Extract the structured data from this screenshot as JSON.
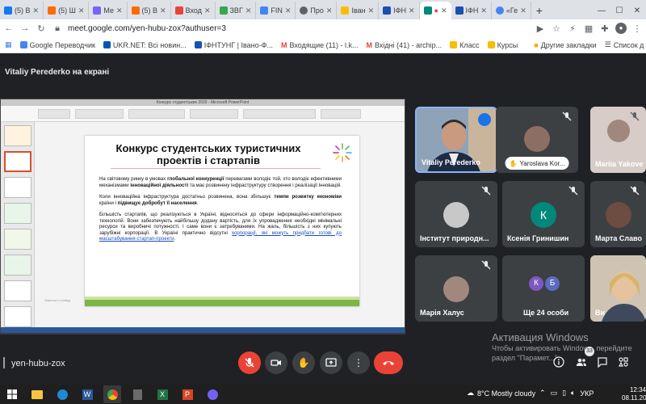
{
  "browser": {
    "tabs": [
      {
        "label": "(5) В",
        "favicon_color": "#1877f2",
        "active": false
      },
      {
        "label": "(5) Ш",
        "favicon_color": "#ff6a00",
        "active": false
      },
      {
        "label": "Ме",
        "favicon_color": "#7b61ff",
        "active": false
      },
      {
        "label": "(5) В",
        "favicon_color": "#ff6a00",
        "active": false
      },
      {
        "label": "Вход",
        "favicon_color": "#ea4335",
        "active": false
      },
      {
        "label": "ЗВГ",
        "favicon_color": "#34a853",
        "active": false
      },
      {
        "label": "FIN",
        "favicon_color": "#4285f4",
        "active": false
      },
      {
        "label": "Про",
        "favicon_color": "#5f6368",
        "active": false
      },
      {
        "label": "Іван",
        "favicon_color": "#fbbc04",
        "active": false
      },
      {
        "label": "ІФН",
        "favicon_color": "#1a4fb5",
        "active": false
      },
      {
        "label": "",
        "favicon_color": "#00897b",
        "active": true
      },
      {
        "label": "ІФН",
        "favicon_color": "#1a4fb5",
        "active": false
      },
      {
        "label": "«Ге",
        "favicon_color": "#4285f4",
        "active": false
      }
    ],
    "url": "meet.google.com/yen-hubu-zox?authuser=3",
    "bookmarks": [
      {
        "label": "Приложения",
        "icon": "apps-grid-icon"
      },
      {
        "label": "Google Переводчик",
        "icon": "translate-icon"
      },
      {
        "label": "UKR.NET: Всі новин...",
        "icon": "ukrnet-icon"
      },
      {
        "label": "ІФНТУНГ | Івано-Ф...",
        "icon": "university-icon"
      },
      {
        "label": "Входящие (11) - l.k...",
        "icon": "gmail-icon"
      },
      {
        "label": "Вхідні (41) - archip...",
        "icon": "gmail-icon"
      },
      {
        "label": "Класс",
        "icon": "classroom-icon"
      },
      {
        "label": "Курсы",
        "icon": "classroom-icon"
      },
      {
        "label": "Другие закладки",
        "icon": "folder-icon"
      },
      {
        "label": "Список д",
        "icon": "reading-list-icon"
      }
    ]
  },
  "meet": {
    "presenter_label": "Vitaliy Perederko на екрані",
    "meeting_code": "yen-hubu-zox",
    "participants": [
      {
        "name": "Vitaliy Perederko",
        "kind": "video",
        "speaking": true,
        "muted": false
      },
      {
        "name": "Yaroslava Kor...",
        "kind": "photo",
        "hand_raised": true,
        "muted": true,
        "avatar_color": "#8d6e63"
      },
      {
        "name": "Mariia Yakove",
        "kind": "photo",
        "muted": true,
        "avatar_color": "#d7ccc8"
      },
      {
        "name": "Інститут природн...",
        "kind": "photo",
        "muted": true,
        "avatar_color": "#c8c8c8"
      },
      {
        "name": "Ксенія Гринишин",
        "kind": "letter",
        "letter": "К",
        "muted": true,
        "avatar_color": "#00897b"
      },
      {
        "name": "Марта Славо",
        "kind": "photo",
        "muted": true,
        "avatar_color": "#6d4c41"
      },
      {
        "name": "Марія Халус",
        "kind": "photo",
        "muted": true,
        "avatar_color": "#a1887f"
      },
      {
        "name": "Ще 24 особи",
        "kind": "group",
        "letters": [
          "К",
          "Б"
        ],
        "group_colors": [
          "#7e57c2",
          "#5c6bc0"
        ]
      },
      {
        "name": "Ви",
        "kind": "video",
        "muted": false
      }
    ],
    "badge_count": "33"
  },
  "slide": {
    "window_title": "Конкурс студентських 2020 - Microsoft PowerPoint",
    "title": "Конкурс студентських туристичних проектів і стартапів",
    "p1_a": "На світовому ринку в умовах ",
    "p1_b": "глобальної конкуренції",
    "p1_c": " перевагами володіє той, хто володіє ефективними механізмами ",
    "p1_d": "інноваційної діяльності",
    "p1_e": " та має розвинену інфраструктуру створення і реалізації інновацій.",
    "p2_a": "Коли інноваційна інфраструктура достатньо розвинена, вона збільшує ",
    "p2_b": "темпи розвитку економіки",
    "p2_c": " країни і ",
    "p2_d": "підвищує добробут її населення",
    "p2_e": ".",
    "p3_a": "Більшість стартапів, що реалізуються в Україні, відносяться до сфери інформаційно-комп'ютерних технологій. Вони забезпечують найбільшу додану вартість, для їх упровадження необхідні мінімальні ресурси та виробничі потужності. І саме вони є затребуваними. На жаль, більшість з них купують зарубіжні корпорації. В Україні практично відсутні ",
    "p3_link": "корпорації, які можуть придбати готові до масштабування стартап-проекти",
    "p3_b": ".",
    "notes": "Заметки к слайду"
  },
  "windows": {
    "watermark_title": "Активация Windows",
    "watermark_line1": "Чтобы активировать Windows, перейдите",
    "watermark_line2": "раздел \"Парамет...\".",
    "weather": "8°C  Mostly cloudy",
    "lang": "УКР",
    "time": "12:34",
    "date": "08.11.20"
  },
  "colors": {
    "meet_bg": "#202124",
    "tile_bg": "#3c4043",
    "end_call": "#ea4335",
    "accent": "#8ab4f8",
    "slide_green": "#7fb545"
  }
}
